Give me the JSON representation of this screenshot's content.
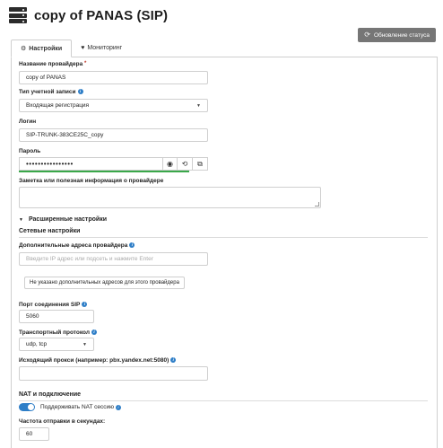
{
  "header": {
    "title": "copy of PANAS (SIP)",
    "status_button": "Обновление статуса"
  },
  "tabs": [
    {
      "label": "Настройки",
      "icon": "gears-icon",
      "active": true
    },
    {
      "label": "Мониторинг",
      "icon": "heartbeat-icon",
      "active": false
    }
  ],
  "form": {
    "provider_name": {
      "label": "Название провайдера",
      "required_mark": "*",
      "value": "copy of PANAS"
    },
    "account_type": {
      "label": "Тип учетной записи",
      "value": "Входящая регистрация"
    },
    "login": {
      "label": "Логин",
      "value": "SIP-TRUNK-383CE25C_copy"
    },
    "password": {
      "label": "Пароль",
      "value": "••••••••••••••••",
      "strength_color": "#3aa84a"
    },
    "note": {
      "label": "Заметка или полезная информация о провайдере",
      "value": ""
    }
  },
  "advanced": {
    "toggle_label": "Расширенные настройки",
    "network_title": "Сетевые настройки",
    "additional_hosts": {
      "label": "Дополнительные адреса провайдера",
      "placeholder": "Введите IP адрес или подсеть и нажмите Enter"
    },
    "no_hosts_button": "Не указано дополнительных адресов для этого провайдера",
    "sip_port": {
      "label": "Порт соединения SIP",
      "value": "5060"
    },
    "transport": {
      "label": "Транспортный протокол",
      "value": "udp, tcp"
    },
    "outbound_proxy": {
      "label": "Исходящий прокси (например: pbx.yandex.net:5080)",
      "value": ""
    },
    "nat_title": "NAT и подключение",
    "nat_keepalive": {
      "label": "Поддерживать NAT сессию",
      "enabled": true
    },
    "qualify_freq": {
      "label": "Частота отправки в секундах:",
      "value": "60"
    }
  },
  "colors": {
    "accent": "#2e7ec7",
    "status_button_bg": "#767676"
  }
}
